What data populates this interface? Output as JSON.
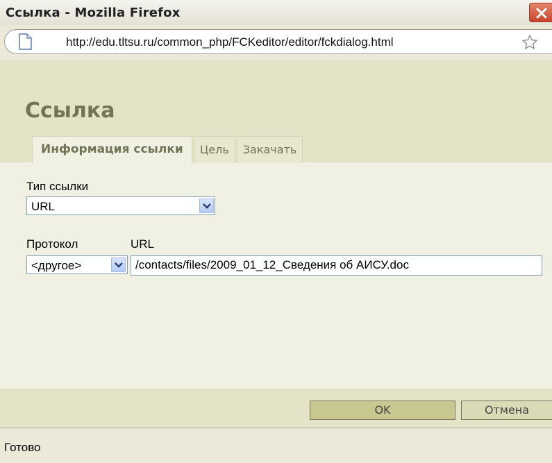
{
  "window": {
    "title": "Ссылка - Mozilla Firefox"
  },
  "address_bar": {
    "url": "http://edu.tltsu.ru/common_php/FCKeditor/editor/fckdialog.html"
  },
  "dialog": {
    "title": "Ссылка",
    "tabs": [
      {
        "label": "Информация ссылки",
        "active": true
      },
      {
        "label": "Цель",
        "active": false
      },
      {
        "label": "Закачать",
        "active": false
      }
    ],
    "link_type": {
      "label": "Тип ссылки",
      "value": "URL"
    },
    "protocol": {
      "label": "Протокол",
      "value": "<другое>"
    },
    "url": {
      "label": "URL",
      "value": "/contacts/files/2009_01_12_Сведения об АИСУ.doc"
    },
    "buttons": {
      "ok": "OK",
      "cancel": "Отмена"
    }
  },
  "status": {
    "text": "Готово"
  },
  "colors": {
    "dialog_header": "#e3e3c7",
    "dialog_body": "#f1f1e3",
    "title_accent": "#737357",
    "ok_button": "#c7c78f",
    "close_button": "#c9442a"
  },
  "icons": [
    "close-icon",
    "page-icon",
    "bookmark-star-icon",
    "chevron-down-icon"
  ]
}
